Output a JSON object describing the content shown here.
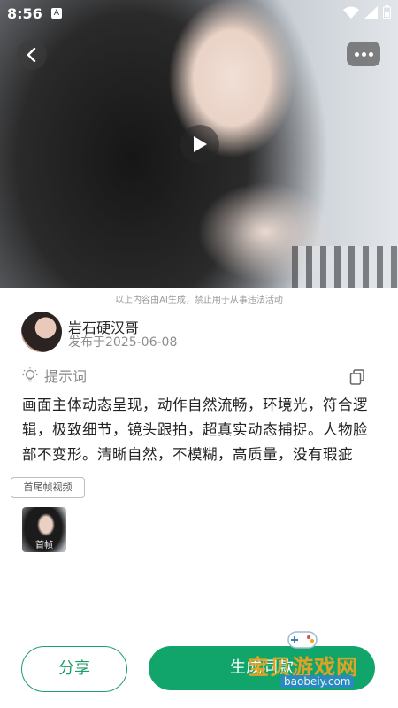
{
  "status_bar": {
    "time": "8:56",
    "notification_badge": "A"
  },
  "hero": {
    "play_icon": "play-icon",
    "back_icon": "chevron-left-icon",
    "more_icon": "more-dots-icon"
  },
  "disclaimer": "以上内容由AI生成，禁止用于从事违法活动",
  "author": {
    "name": "岩石硬汉哥",
    "publish_date": "发布于2025-06-08"
  },
  "prompt": {
    "title": "提示词",
    "text": "画面主体动态呈现，动作自然流畅，环境光，符合逻辑，极致细节，镜头跟拍，超真实动态捕捉。人物脸部不变形。清晰自然，不模糊，高质量，没有瑕疵"
  },
  "tag": "首尾帧视频",
  "frame": {
    "label": "首帧"
  },
  "actions": {
    "share_label": "分享",
    "generate_label": "生成同款"
  },
  "watermark": {
    "text": "宝贝游戏网",
    "url": "baobeiy.com"
  },
  "colors": {
    "accent": "#12a56b",
    "accent_text": "#1f9e6b"
  }
}
